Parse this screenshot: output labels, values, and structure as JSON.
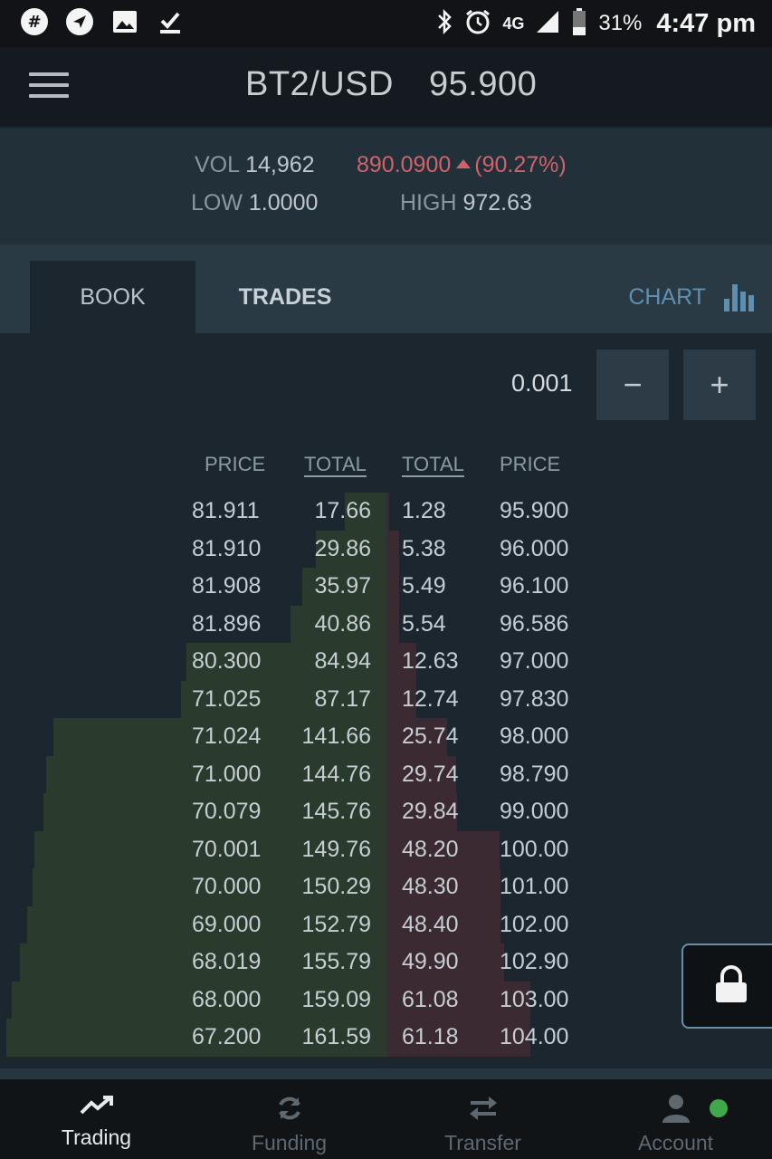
{
  "status_bar": {
    "battery_pct": "31%",
    "time": "4:47 pm",
    "network": "4G",
    "icons_left": [
      "slack-icon",
      "navigation-icon",
      "image-icon",
      "download-done-icon"
    ],
    "icons_right": [
      "bluetooth-icon",
      "alarm-icon",
      "signal-icon",
      "battery-icon"
    ]
  },
  "header": {
    "pair": "BT2/USD",
    "last_price": "95.900"
  },
  "stats": {
    "vol_label": "VOL",
    "vol_value": "14,962",
    "change_value": "890.0900",
    "change_pct": "(90.27%)",
    "low_label": "LOW",
    "low_value": "1.0000",
    "high_label": "HIGH",
    "high_value": "972.63"
  },
  "tabs": {
    "book": "BOOK",
    "trades": "TRADES",
    "chart": "CHART"
  },
  "book": {
    "precision": "0.001",
    "minus": "−",
    "plus": "+",
    "headers": {
      "bid_price": "PRICE",
      "bid_total": "TOTAL",
      "ask_total": "TOTAL",
      "ask_price": "PRICE"
    },
    "max_total": 161.59,
    "rows": [
      {
        "bid_price": "81.911",
        "bid_total": "17.66",
        "ask_total": "1.28",
        "ask_price": "95.900"
      },
      {
        "bid_price": "81.910",
        "bid_total": "29.86",
        "ask_total": "5.38",
        "ask_price": "96.000"
      },
      {
        "bid_price": "81.908",
        "bid_total": "35.97",
        "ask_total": "5.49",
        "ask_price": "96.100"
      },
      {
        "bid_price": "81.896",
        "bid_total": "40.86",
        "ask_total": "5.54",
        "ask_price": "96.586"
      },
      {
        "bid_price": "80.300",
        "bid_total": "84.94",
        "ask_total": "12.63",
        "ask_price": "97.000"
      },
      {
        "bid_price": "71.025",
        "bid_total": "87.17",
        "ask_total": "12.74",
        "ask_price": "97.830"
      },
      {
        "bid_price": "71.024",
        "bid_total": "141.66",
        "ask_total": "25.74",
        "ask_price": "98.000"
      },
      {
        "bid_price": "71.000",
        "bid_total": "144.76",
        "ask_total": "29.74",
        "ask_price": "98.790"
      },
      {
        "bid_price": "70.079",
        "bid_total": "145.76",
        "ask_total": "29.84",
        "ask_price": "99.000"
      },
      {
        "bid_price": "70.001",
        "bid_total": "149.76",
        "ask_total": "48.20",
        "ask_price": "100.00"
      },
      {
        "bid_price": "70.000",
        "bid_total": "150.29",
        "ask_total": "48.30",
        "ask_price": "101.00"
      },
      {
        "bid_price": "69.000",
        "bid_total": "152.79",
        "ask_total": "48.40",
        "ask_price": "102.00"
      },
      {
        "bid_price": "68.019",
        "bid_total": "155.79",
        "ask_total": "49.90",
        "ask_price": "102.90"
      },
      {
        "bid_price": "68.000",
        "bid_total": "159.09",
        "ask_total": "61.08",
        "ask_price": "103.00"
      },
      {
        "bid_price": "67.200",
        "bid_total": "161.59",
        "ask_total": "61.18",
        "ask_price": "104.00"
      }
    ]
  },
  "bottom_nav": {
    "items": [
      {
        "label": "Trading",
        "icon": "trending-up-icon",
        "active": true
      },
      {
        "label": "Funding",
        "icon": "refresh-icon",
        "active": false
      },
      {
        "label": "Transfer",
        "icon": "transfer-icon",
        "active": false
      },
      {
        "label": "Account",
        "icon": "person-icon",
        "active": false
      }
    ]
  },
  "colors": {
    "bid": "#2a3a2c",
    "ask": "#3c2a32",
    "change": "#d0636a",
    "chart_link": "#5f8fb0",
    "online_dot": "#3fa84a"
  }
}
